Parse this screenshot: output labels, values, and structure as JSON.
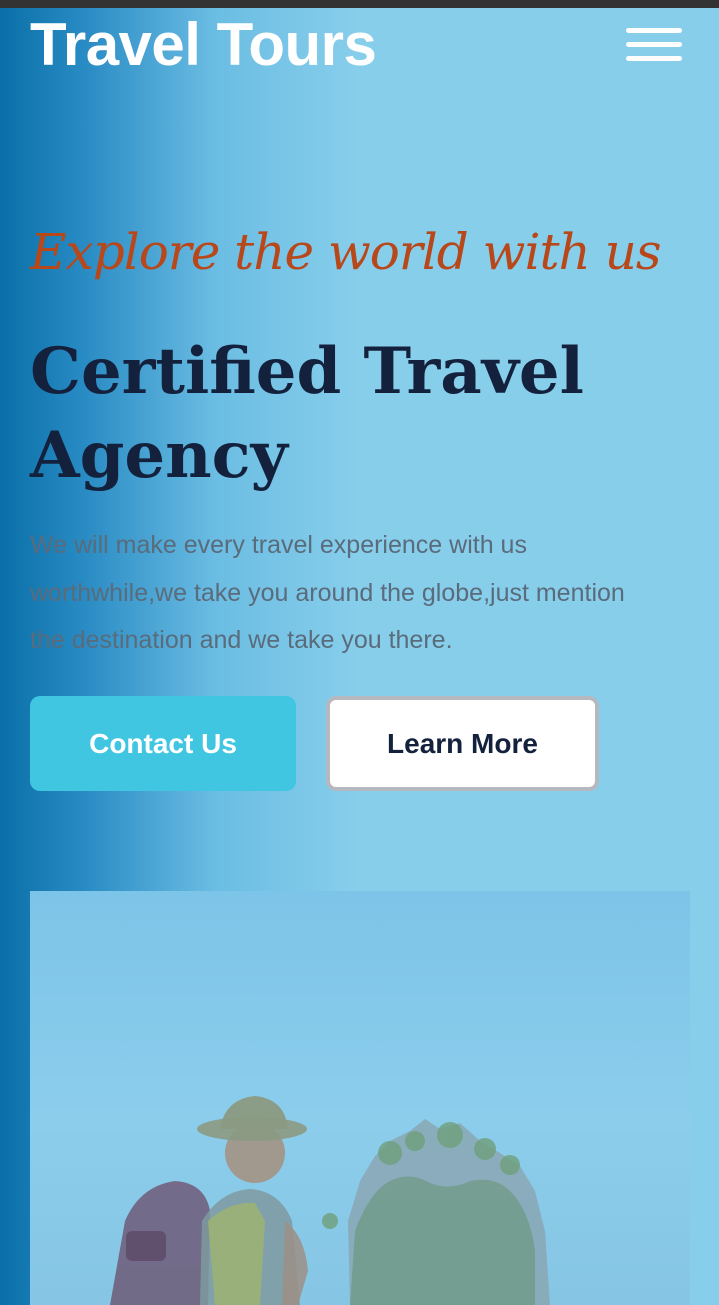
{
  "header": {
    "brand": "Travel Tours",
    "menu_icon": "hamburger-menu-icon"
  },
  "hero": {
    "tagline": "Explore the world with us",
    "title": "Certified Travel Agency",
    "description": "We will make every travel experience with us worthwhile,we take you around the globe,just mention the destination and we take you there.",
    "contact_label": "Contact Us",
    "learn_label": "Learn More"
  },
  "colors": {
    "accent": "#41c6e1",
    "title": "#14213d",
    "tagline": "#b8471a",
    "background": "#87ceeb"
  }
}
